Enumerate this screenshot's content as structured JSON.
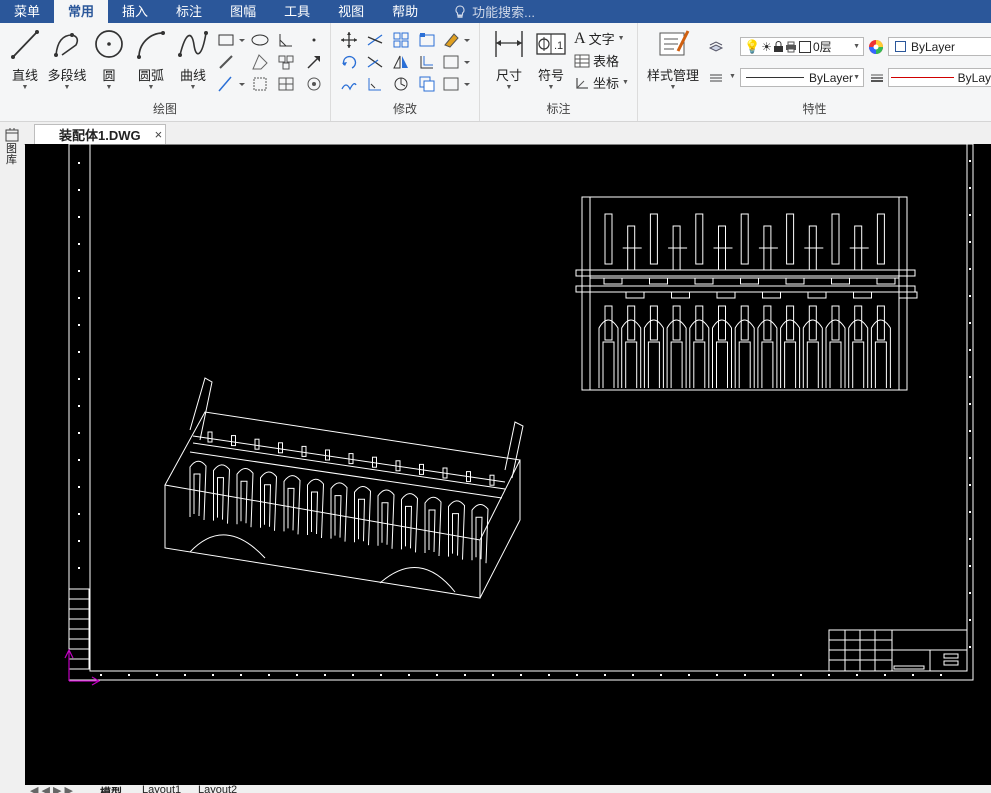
{
  "menubar": {
    "items": [
      {
        "label": "菜单",
        "active": false
      },
      {
        "label": "常用",
        "active": true
      },
      {
        "label": "插入",
        "active": false
      },
      {
        "label": "标注",
        "active": false
      },
      {
        "label": "图幅",
        "active": false
      },
      {
        "label": "工具",
        "active": false
      },
      {
        "label": "视图",
        "active": false
      },
      {
        "label": "帮助",
        "active": false
      }
    ],
    "search_placeholder": "功能搜索..."
  },
  "ribbon": {
    "draw": {
      "group_label": "绘图",
      "line": "直线",
      "polyline": "多段线",
      "circle": "圆",
      "arc": "圆弧",
      "curve": "曲线"
    },
    "modify": {
      "group_label": "修改"
    },
    "annotation": {
      "group_label": "标注",
      "dimension": "尺寸",
      "symbol": "符号",
      "text": "文字",
      "table": "表格",
      "coordinate": "坐标"
    },
    "properties": {
      "group_label": "特性",
      "style_manager": "样式管理",
      "layer": "0层",
      "color": "ByLayer",
      "linetype": "ByLayer",
      "lineweight": "ByLay"
    }
  },
  "document": {
    "tab_name": "装配体1.DWG",
    "close_glyph": "×"
  },
  "sidebar": {
    "label": "图库"
  },
  "layout_tabs": {
    "items": [
      "模型",
      "Layout1",
      "Layout2"
    ]
  },
  "colors": {
    "menubar_bg": "#2b579a",
    "canvas_bg": "#000000",
    "drawing_lines": "#ffffff",
    "ucs_axis": "#c000c0",
    "lineweight_sample": "#d00000"
  },
  "icons": [
    "search-icon",
    "line-icon",
    "polyline-icon",
    "circle-icon",
    "arc-icon",
    "curve-icon",
    "dimension-icon",
    "symbol-icon",
    "text-icon",
    "table-icon",
    "coordinate-icon",
    "style-manager-icon",
    "lightbulb-icon",
    "sun-icon",
    "lock-icon",
    "printer-icon",
    "color-wheel-icon",
    "close-icon",
    "ucs-icon"
  ]
}
